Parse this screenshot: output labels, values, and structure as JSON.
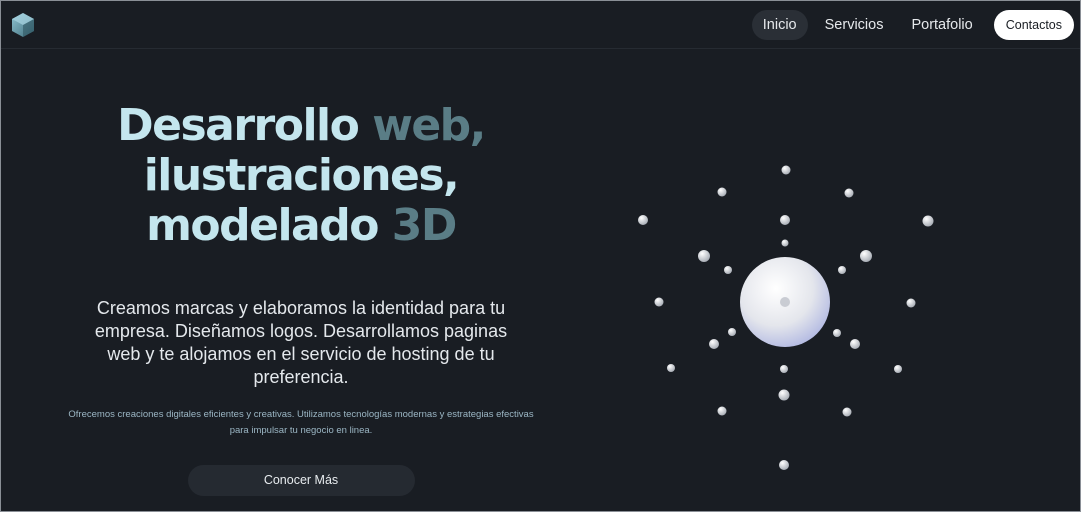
{
  "brand": {
    "logo_icon": "hexagon-cube-icon",
    "accent": "#5a8fa0"
  },
  "nav": {
    "items": [
      {
        "label": "Inicio",
        "active": true
      },
      {
        "label": "Servicios",
        "active": false
      },
      {
        "label": "Portafolio",
        "active": false
      }
    ],
    "contact_label": "Contactos"
  },
  "hero": {
    "headline_1a": "Desarrollo ",
    "headline_1b": "web,",
    "headline_2a": "ilustraciones,",
    "headline_3a": "modelado ",
    "headline_3b": "3D",
    "lead": "Creamos marcas y elaboramos la identidad para tu empresa. Diseñamos logos. Desarrollamos paginas web y te alojamos en el servicio de hosting de tu preferencia.",
    "small": "Ofrecemos creaciones digitales eficientes y creativas. Utilizamos tecnologías modernas y estrategias efectivas para impulsar tu negocio en linea.",
    "cta_label": "Conocer Más"
  },
  "colors": {
    "headline_light": "#c4e6ee",
    "headline_dark": "#5a7d86",
    "background": "#191d23"
  }
}
